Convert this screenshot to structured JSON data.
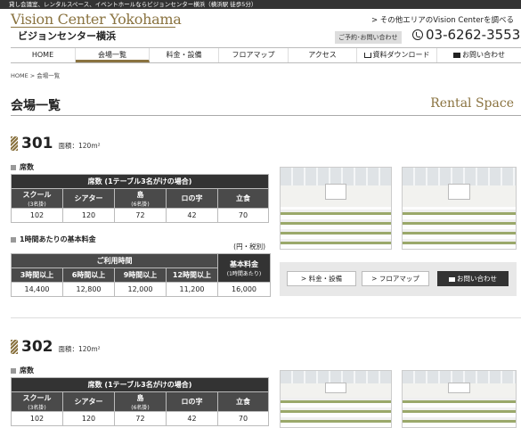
{
  "topbar": {
    "text": "貸し会議室、レンタルスペース、イベントホールならビジョンセンター横浜（横浜駅 徒歩5分）"
  },
  "header": {
    "logo_en": "Vision Center Yokohama",
    "logo_jp": "ビジョンセンター横浜",
    "other_area": "> その他エリアのVision Centerを調べる",
    "contact_label": "ご予約･お問い合わせ",
    "phone": "03-6262-3553"
  },
  "nav": {
    "items": [
      {
        "label": "HOME",
        "icon": ""
      },
      {
        "label": "会場一覧",
        "icon": ""
      },
      {
        "label": "料金・設備",
        "icon": ""
      },
      {
        "label": "フロアマップ",
        "icon": ""
      },
      {
        "label": "アクセス",
        "icon": ""
      },
      {
        "label": "資料ダウンロード",
        "icon": "download-icon"
      },
      {
        "label": "お問い合わせ",
        "icon": "mail-icon"
      }
    ],
    "active": "会場一覧"
  },
  "breadcrumb": "HOME > 会場一覧",
  "page": {
    "title": "会場一覧",
    "subtitle": "Rental Space"
  },
  "rooms": [
    {
      "number": "301",
      "area": "面積：120m²",
      "seats_heading": "席数",
      "seats_table_title": "席数 (1テーブル3名がけの場合)",
      "seat_columns": [
        {
          "label": "スクール",
          "note": "(3名掛)"
        },
        {
          "label": "シアター",
          "note": ""
        },
        {
          "label": "島",
          "note": "(6名掛)"
        },
        {
          "label": "ロの字",
          "note": ""
        },
        {
          "label": "立食",
          "note": ""
        }
      ],
      "seat_values": [
        "102",
        "120",
        "72",
        "42",
        "70"
      ],
      "price_heading": "1時間あたりの基本料金",
      "price_note": "(円・税別)",
      "price_group_title": "ご利用時間",
      "price_columns": [
        "3時間以上",
        "6時間以上",
        "9時間以上",
        "12時間以上"
      ],
      "base_label": "基本料金",
      "base_note": "(1時間あたり)",
      "price_values": [
        "14,400",
        "12,800",
        "12,000",
        "11,200",
        "16,000"
      ],
      "buttons": {
        "equipment": "料金・設備",
        "floormap": "フロアマップ",
        "contact": "お問い合わせ"
      }
    },
    {
      "number": "302",
      "area": "面積：120m²",
      "seats_heading": "席数",
      "seats_table_title": "席数 (1テーブル3名がけの場合)",
      "seat_columns": [
        {
          "label": "スクール",
          "note": "(3名掛)"
        },
        {
          "label": "シアター",
          "note": ""
        },
        {
          "label": "島",
          "note": "(6名掛)"
        },
        {
          "label": "ロの字",
          "note": ""
        },
        {
          "label": "立食",
          "note": ""
        }
      ],
      "seat_values": [
        "102",
        "120",
        "72",
        "42",
        "70"
      ]
    }
  ]
}
